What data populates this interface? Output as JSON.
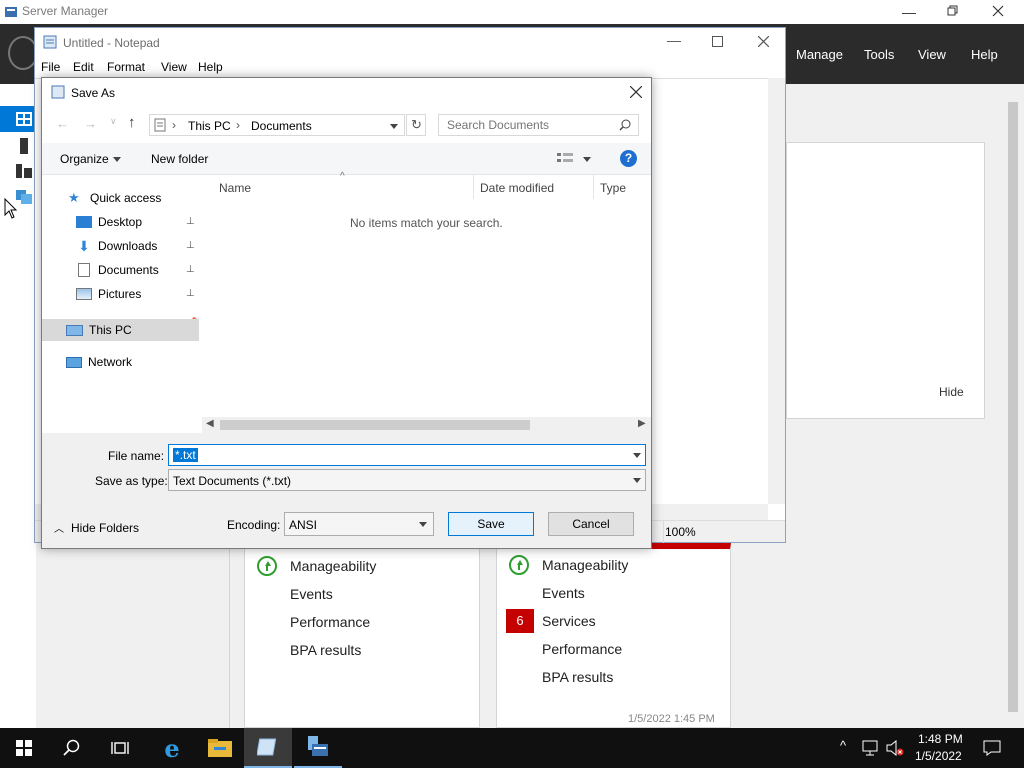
{
  "server_manager": {
    "title": "Server Manager",
    "menu": {
      "manage": "Manage",
      "tools": "Tools",
      "view": "View",
      "help": "Help"
    },
    "hide_label": "Hide",
    "tile_left": {
      "items": [
        "Manageability",
        "Events",
        "Performance",
        "BPA results"
      ]
    },
    "tile_right": {
      "badge": "6",
      "items": [
        "Manageability",
        "Events",
        "Services",
        "Performance",
        "BPA results"
      ],
      "timestamp": "1/5/2022 1:45 PM"
    }
  },
  "notepad": {
    "title": "Untitled - Notepad",
    "menu": [
      "File",
      "Edit",
      "Format",
      "View",
      "Help"
    ],
    "zoom": "100%"
  },
  "save_dialog": {
    "title": "Save As",
    "breadcrumb": [
      "This PC",
      "Documents"
    ],
    "search_placeholder": "Search Documents",
    "organize_label": "Organize",
    "new_folder_label": "New folder",
    "nav": {
      "quick_access": "Quick access",
      "desktop": "Desktop",
      "downloads": "Downloads",
      "documents": "Documents",
      "pictures": "Pictures",
      "this_pc": "This PC",
      "network": "Network"
    },
    "columns": {
      "name": "Name",
      "date_modified": "Date modified",
      "type": "Type"
    },
    "empty_message": "No items match your search.",
    "file_name_label": "File name:",
    "file_name_value": "*.txt",
    "save_as_type_label": "Save as type:",
    "save_as_type_value": "Text Documents (*.txt)",
    "hide_folders_label": "Hide Folders",
    "encoding_label": "Encoding:",
    "encoding_value": "ANSI",
    "save_label": "Save",
    "cancel_label": "Cancel"
  },
  "taskbar": {
    "time": "1:48 PM",
    "date": "1/5/2022"
  },
  "colors": {
    "sm_bar": "#2b2b2b",
    "accent_blue": "#0078d7",
    "selected_nav": "#d9d9d9",
    "badge_red": "#c50000",
    "taskbar": "#101010"
  }
}
